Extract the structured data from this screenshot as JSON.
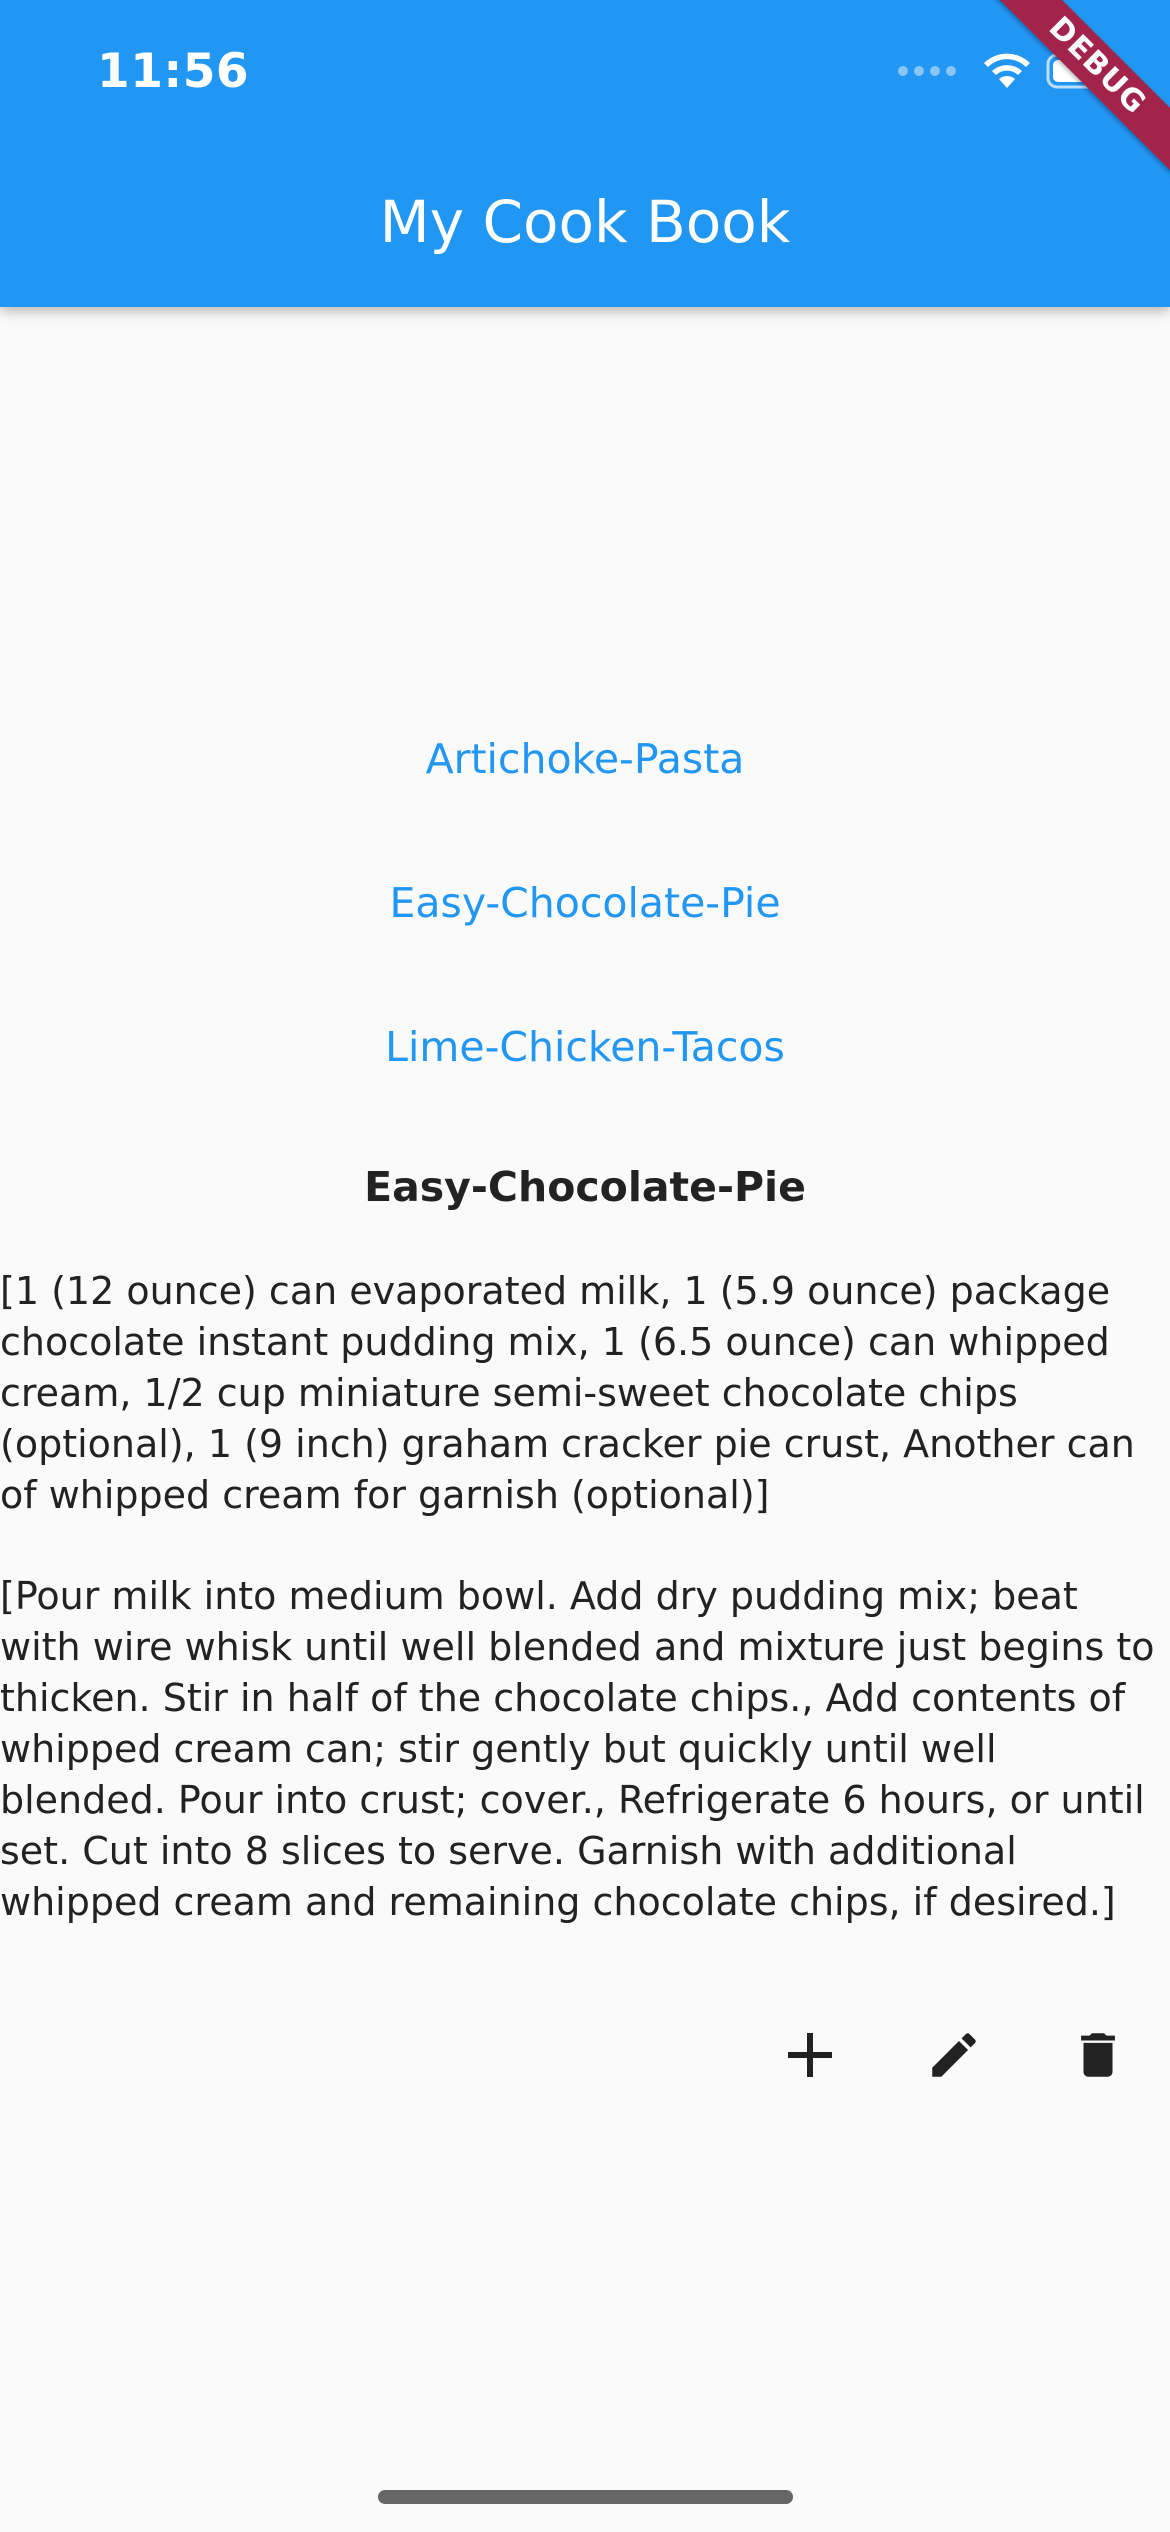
{
  "status_bar": {
    "time": "11:56"
  },
  "app_bar": {
    "title": "My Cook Book",
    "debug_banner": "DEBUG",
    "color": "#2196f3"
  },
  "recipes": [
    {
      "label": "Artichoke-Pasta"
    },
    {
      "label": "Easy-Chocolate-Pie"
    },
    {
      "label": "Lime-Chicken-Tacos"
    }
  ],
  "selected_recipe": {
    "title": "Easy-Chocolate-Pie",
    "ingredients": "[1 (12 ounce) can evaporated milk, 1 (5.9 ounce) package chocolate instant pudding mix, 1 (6.5 ounce) can whipped cream, 1/2 cup miniature semi-sweet chocolate chips (optional), 1 (9 inch) graham cracker pie crust, Another can of whipped cream for garnish (optional)]",
    "directions": "[Pour milk into medium bowl. Add dry pudding mix; beat with wire whisk until well blended and mixture just begins to thicken. Stir in half of the chocolate chips., Add contents of whipped cream can; stir gently but quickly until well blended. Pour into crust; cover., Refrigerate 6 hours, or until set. Cut into 8 slices to serve. Garnish with additional whipped cream and remaining chocolate chips, if desired.]"
  },
  "actions": {
    "add_icon": "add-icon",
    "edit_icon": "pencil-icon",
    "delete_icon": "trash-icon"
  }
}
